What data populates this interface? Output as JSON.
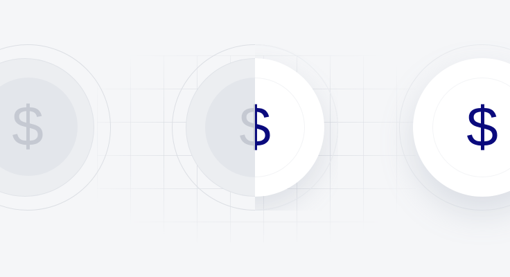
{
  "symbols": {
    "left_coin": "$",
    "middle_coin_muted": "$",
    "middle_coin_active": "$",
    "right_coin": "$"
  },
  "colors": {
    "background": "#f5f6f8",
    "muted_symbol": "#c5c9d2",
    "active_symbol": "#0a0a7d",
    "coin_face": "#ffffff",
    "muted_face": "#e3e6eb"
  },
  "icons": [
    "dollar-coin-icon"
  ]
}
